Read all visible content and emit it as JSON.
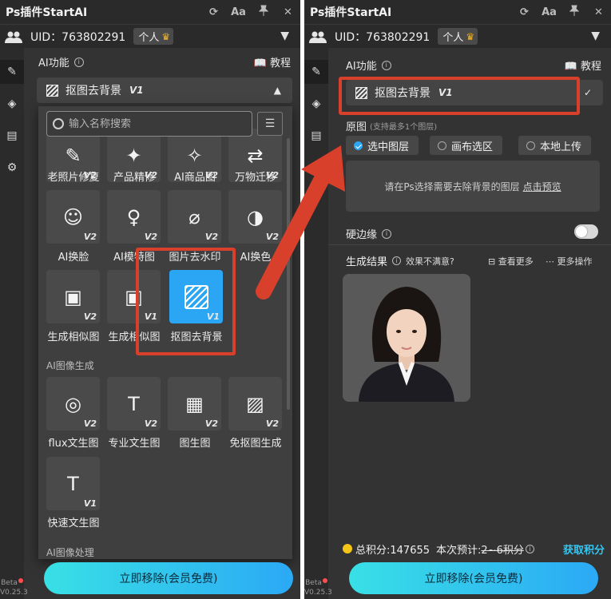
{
  "app_title": "Ps插件StartAI",
  "titlebar_icons": {
    "refresh": "⟳",
    "font": "Aa",
    "pin": "📌",
    "close": "✕"
  },
  "user": {
    "uid": "UID：763802291",
    "tier": "个人",
    "crown": "♛"
  },
  "sidebar": {
    "beta": "Beta",
    "version": "V0.25.3"
  },
  "section": {
    "label": "AI功能",
    "info": "i",
    "tutorial": "教程"
  },
  "selected_function": {
    "name": "抠图去背景",
    "version": "V1"
  },
  "search": {
    "placeholder": "输入名称搜索"
  },
  "grid": {
    "row1": [
      {
        "label": "老照片修复",
        "ver": "V2",
        "icon": "✎"
      },
      {
        "label": "产品精修",
        "ver": "V2",
        "icon": "✦"
      },
      {
        "label": "AI商品图",
        "ver": "V2",
        "icon": "✧"
      },
      {
        "label": "万物迁移",
        "ver": "V2",
        "icon": "⇄"
      }
    ],
    "row2": [
      {
        "label": "AI换脸",
        "ver": "V2",
        "icon": "☺"
      },
      {
        "label": "AI模特图",
        "ver": "V2",
        "icon": "♀"
      },
      {
        "label": "图片去水印",
        "ver": "V2",
        "icon": "⌀"
      },
      {
        "label": "AI换色",
        "ver": "V2",
        "icon": "◑"
      }
    ],
    "row3": [
      {
        "label": "生成相似图",
        "ver": "V2",
        "icon": "▣"
      },
      {
        "label": "生成相似图",
        "ver": "V1",
        "icon": "▣"
      },
      {
        "label": "抠图去背景",
        "ver": "V1",
        "icon": ""
      }
    ],
    "category_gen": "AI图像生成",
    "row4": [
      {
        "label": "flux文生图",
        "ver": "V2",
        "icon": "◎"
      },
      {
        "label": "专业文生图",
        "ver": "V2",
        "icon": "T"
      },
      {
        "label": "图生图",
        "ver": "V2",
        "icon": "▦"
      },
      {
        "label": "免抠图生成",
        "ver": "V2",
        "icon": "▨"
      }
    ],
    "row5": [
      {
        "label": "快速文生图",
        "ver": "V1",
        "icon": "T"
      }
    ],
    "category_proc": "AI图像处理"
  },
  "source": {
    "label": "原图",
    "note": "(支持最多1个图层)",
    "options": [
      "选中图层",
      "画布选区",
      "本地上传"
    ],
    "selected": "选中图层"
  },
  "hint": {
    "text": "请在Ps选择需要去除背景的图层",
    "link": "点击预览"
  },
  "hard_edge": {
    "label": "硬边缘",
    "enabled": false
  },
  "results": {
    "label": "生成结果",
    "unsatisfied": "效果不满意?",
    "view_more": "查看更多",
    "more_actions": "更多操作"
  },
  "points": {
    "total": "总积分:147655",
    "estimate_label": "本次预计:",
    "estimate": "2~6积分",
    "get": "获取积分"
  },
  "cta": "立即移除(会员免费)",
  "colors": {
    "accent": "#2aa6f5",
    "highlight": "#d9402b",
    "cta_start": "#38e0e6",
    "cta_end": "#2ba9f5",
    "coin": "#f5c518"
  }
}
